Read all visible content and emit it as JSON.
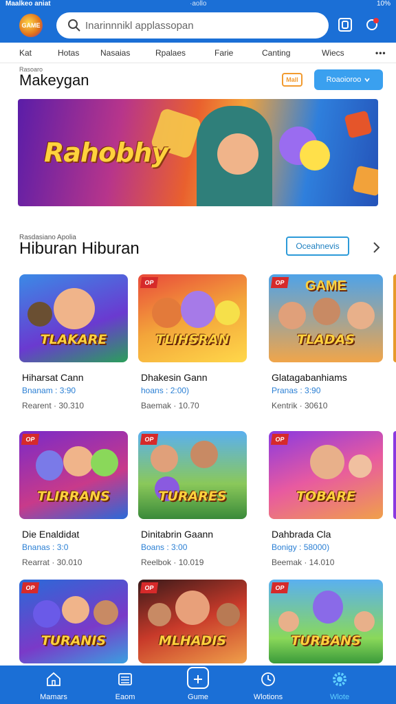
{
  "status": {
    "left": "Maalkeo aniat",
    "center": "·aollo",
    "right": "10%"
  },
  "header": {
    "logo_text": "GAME",
    "search_placeholder": "Inarinnnikl applassopan"
  },
  "categories": [
    "Kat",
    "Hotas",
    "Nasaias",
    "Rpalaes",
    "Farie",
    "Canting",
    "Wiecs",
    "•••"
  ],
  "page": {
    "mini_label": "Rasoaro",
    "title": "Makeygan",
    "badge": "Mall",
    "primary_button": "Roaoioroo"
  },
  "banner": {
    "title": "Rahobhy"
  },
  "section": {
    "mini_label": "Rasdasiano Apolia",
    "title": "Hiburan Hiburan",
    "button": "Oceahnevis"
  },
  "games": [
    {
      "thumb_title": "TLAKARE",
      "thumb_top": "",
      "corner": "",
      "name": "Hiharsat Cann",
      "meta1": "Bnanam : 3:90",
      "meta2": "Rearent · 30.310"
    },
    {
      "thumb_title": "TLIHSRAN",
      "thumb_top": "",
      "corner": "OP",
      "name": "Dhakesin Gann",
      "meta1": "hoans : 2:00)",
      "meta2": "Baemak · 10.70"
    },
    {
      "thumb_title": "TLADAS",
      "thumb_top": "GAME",
      "corner": "OP",
      "name": "Glatagabanhiams",
      "meta1": "Pranas : 3:90",
      "meta2": "Kentrik · 30610"
    },
    {
      "thumb_title": "TLIRRANS",
      "thumb_top": "",
      "corner": "OP",
      "name": "Die Enaldidat",
      "meta1": "Bnanas : 3:0",
      "meta2": "Rearrat · 30.010"
    },
    {
      "thumb_title": "TURARES",
      "thumb_top": "",
      "corner": "OP",
      "name": "Dinitabrin Gaann",
      "meta1": "Boans : 3:00",
      "meta2": "Reelbok · 10.019"
    },
    {
      "thumb_title": "TOBARE",
      "thumb_top": "",
      "corner": "OP",
      "name": "Dahbrada Cla",
      "meta1": "Bonigy : 58000)",
      "meta2": "Beemak · 14.010"
    },
    {
      "thumb_title": "TURANIS",
      "thumb_top": "",
      "corner": "OP",
      "name": "",
      "meta1": "",
      "meta2": ""
    },
    {
      "thumb_title": "MLHADIS",
      "thumb_top": "",
      "corner": "OP",
      "name": "",
      "meta1": "",
      "meta2": ""
    },
    {
      "thumb_title": "TURBANS",
      "thumb_top": "",
      "corner": "OP",
      "name": "",
      "meta1": "",
      "meta2": ""
    }
  ],
  "bottom_nav": [
    {
      "label": "Mamars",
      "icon": "home-icon"
    },
    {
      "label": "Eaom",
      "icon": "list-icon"
    },
    {
      "label": "Gume",
      "icon": "gamepad-icon"
    },
    {
      "label": "Wlotions",
      "icon": "clock-icon"
    },
    {
      "label": "Wlote",
      "icon": "gear-icon"
    }
  ],
  "colors": {
    "primary": "#1b6fd6",
    "accent": "#3aa0ef",
    "active_tab": "#5fd0ff"
  }
}
